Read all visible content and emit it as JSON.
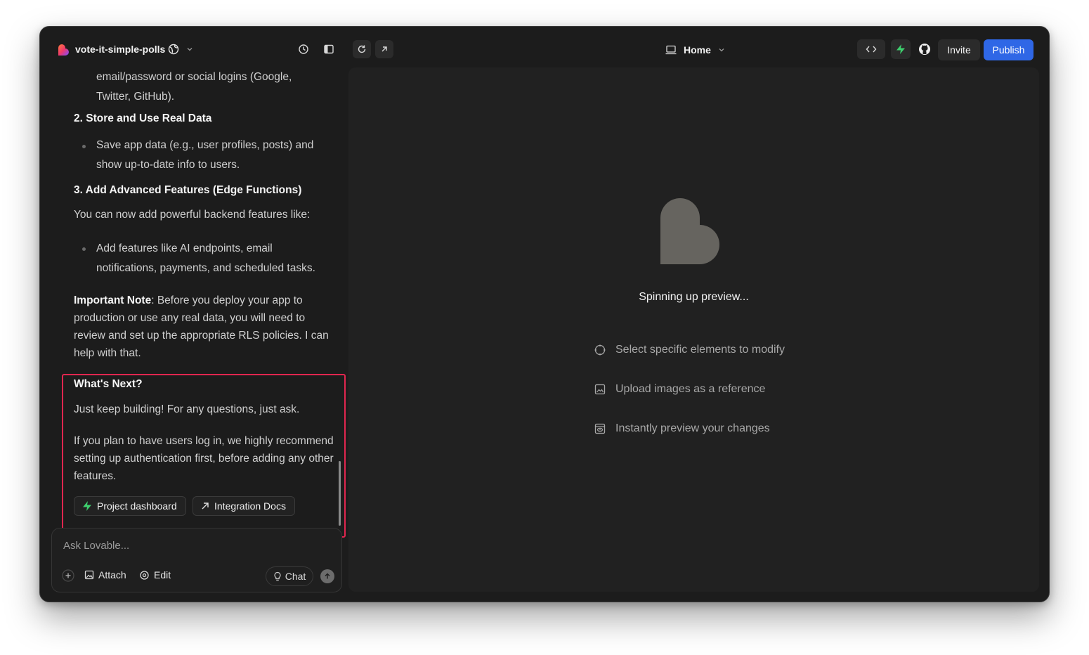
{
  "header": {
    "project_name": "vote-it-simple-polls",
    "page_selector": "Home",
    "invite_label": "Invite",
    "publish_label": "Publish"
  },
  "chat": {
    "intro_line1": "email/password or social logins (Google,",
    "intro_line2": "Twitter, GitHub).",
    "section2_title": "2. Store and Use Real Data",
    "section2_bullet": "Save app data (e.g., user profiles, posts) and show up-to-date info to users.",
    "section3_title": "3. Add Advanced Features (Edge Functions)",
    "section3_lead": "You can now add powerful backend features like:",
    "section3_bullet": "Add features like AI endpoints, email notifications, payments, and scheduled tasks.",
    "note_bold": "Important Note",
    "note_text": ": Before you deploy your app to production or use any real data, you will need to review and set up the appropriate RLS policies. I can help with that.",
    "next_title": "What's Next?",
    "next_p1": "Just keep building! For any questions, just ask.",
    "next_p2": "If you plan to have users log in, we highly recommend setting up authentication first, before adding any other features.",
    "chip_dashboard": "Project dashboard",
    "chip_docs": "Integration Docs"
  },
  "composer": {
    "placeholder": "Ask Lovable...",
    "attach_label": "Attach",
    "edit_label": "Edit",
    "chat_label": "Chat"
  },
  "preview": {
    "status": "Spinning up preview...",
    "hints": [
      "Select specific elements to modify",
      "Upload images as a reference",
      "Instantly preview your changes"
    ]
  },
  "colors": {
    "publish": "#2f67e6",
    "highlight": "#e0264f",
    "accent_green": "#3ecf6e"
  }
}
